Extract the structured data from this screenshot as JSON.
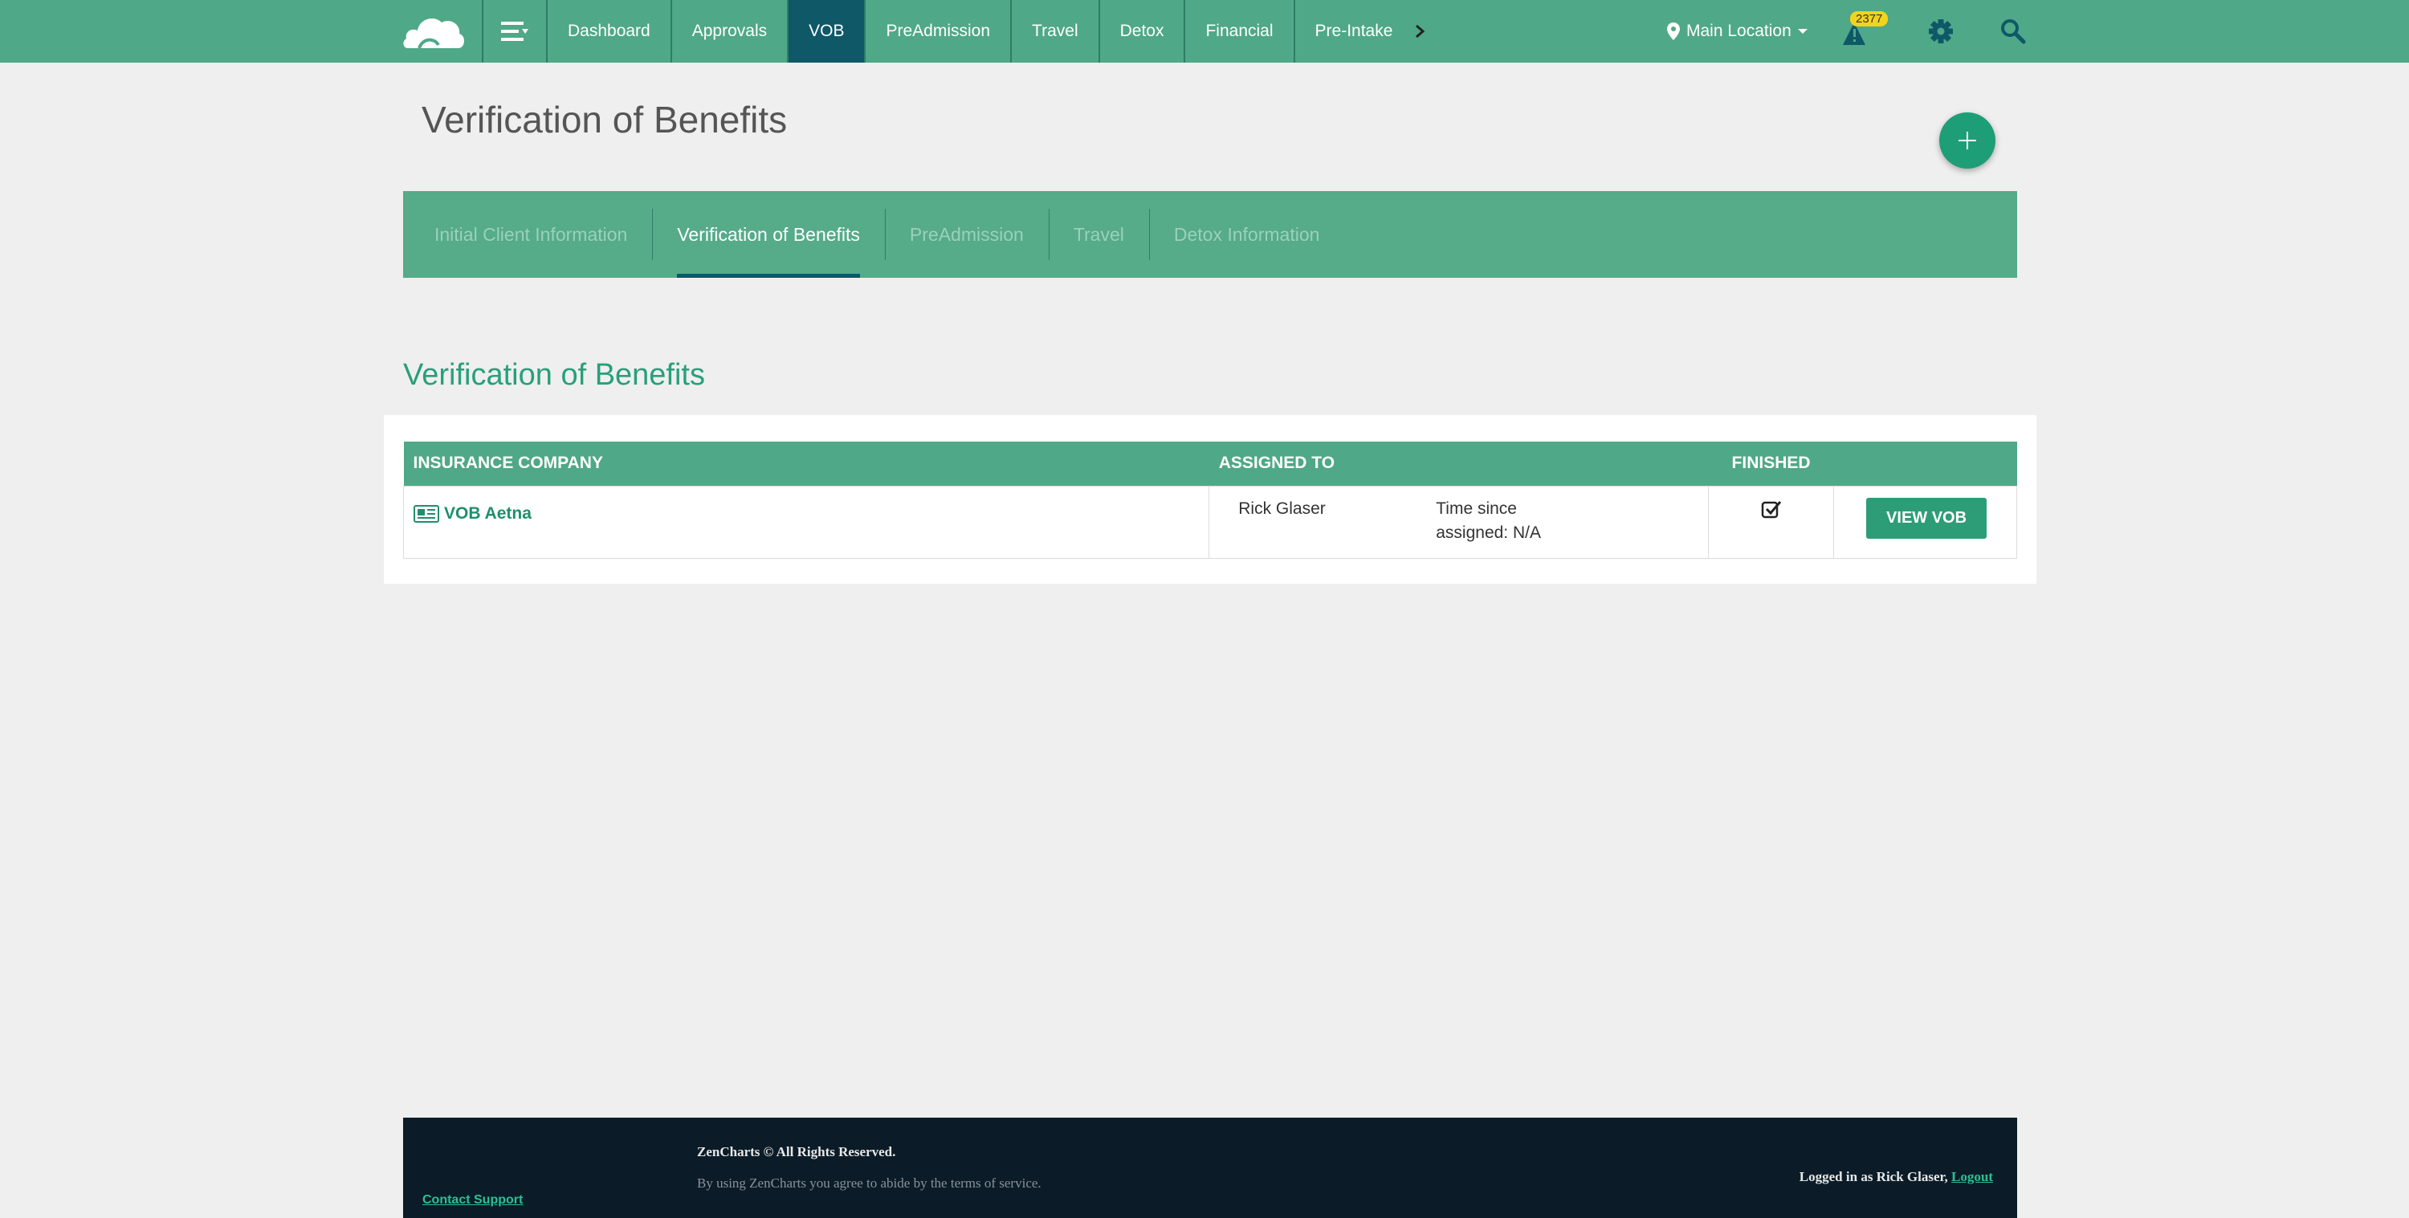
{
  "nav": {
    "items": [
      {
        "label": "Dashboard"
      },
      {
        "label": "Approvals"
      },
      {
        "label": "VOB"
      },
      {
        "label": "PreAdmission"
      },
      {
        "label": "Travel"
      },
      {
        "label": "Detox"
      },
      {
        "label": "Financial"
      },
      {
        "label": "Pre-Intake"
      }
    ],
    "active": "VOB",
    "more_icon": "chevron-right-icon",
    "location": "Main Location",
    "alert_count": "2377"
  },
  "page": {
    "title": "Verification of Benefits"
  },
  "tabs": [
    {
      "label": "Initial Client Information"
    },
    {
      "label": "Verification of Benefits"
    },
    {
      "label": "PreAdmission"
    },
    {
      "label": "Travel"
    },
    {
      "label": "Detox Information"
    }
  ],
  "section": {
    "title": "Verification of Benefits",
    "table": {
      "headers": {
        "insurance": "INSURANCE COMPANY",
        "assigned": "ASSIGNED TO",
        "finished": "FINISHED"
      },
      "rows": [
        {
          "insurance": "VOB Aetna",
          "assignee": "Rick Glaser",
          "time_since_line1": "Time since",
          "time_since_line2": "assigned: N/A",
          "finished": true,
          "action": "VIEW VOB"
        }
      ]
    }
  },
  "footer": {
    "copyright": "ZenCharts © All Rights Reserved.",
    "terms": "By using ZenCharts you agree to abide by the terms of service.",
    "support": "Contact Support",
    "logged_in": "Logged in as Rick Glaser,",
    "logout": "Logout"
  },
  "colors": {
    "brand_green": "#4fa887",
    "active_teal": "#0e5868",
    "accent_green": "#28a07a",
    "footer_bg": "#0b1c28",
    "badge_yellow": "#f1d41c"
  }
}
